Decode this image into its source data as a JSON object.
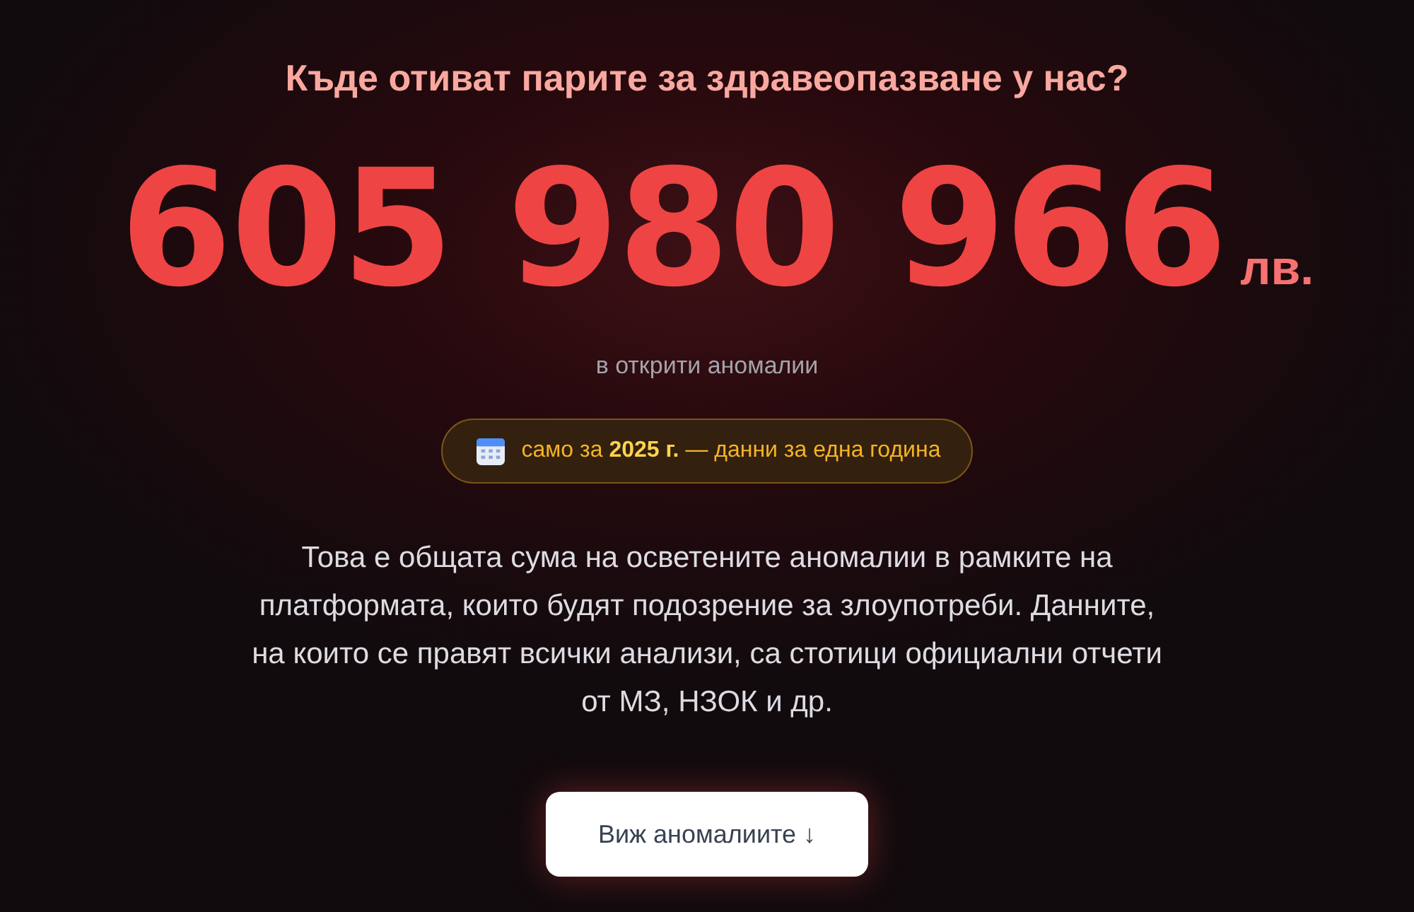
{
  "heading": "Къде отиват парите за здравеопазване у нас?",
  "total": {
    "amount": "605 980 966",
    "currency": "лв."
  },
  "subtitle": "в открити аномалии",
  "period_badge": {
    "text": "само за **2025 г.** — данни за една година"
  },
  "description": "Това е общата сума на осветените аномалии в рамките на платформата, които будят подозрение за злоупотреби. Данните, на които се правят всички анализи, са стотици официални отчети от МЗ, НЗОК и др.",
  "cta_button": {
    "label": "Виж аномалиите ↓"
  }
}
